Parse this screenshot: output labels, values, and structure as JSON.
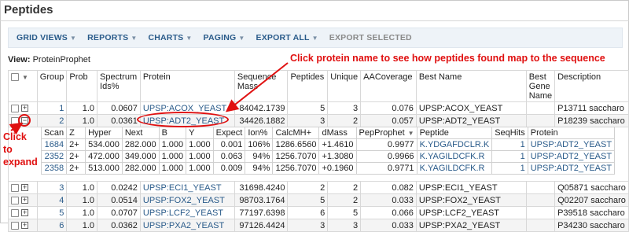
{
  "title": "Peptides",
  "toolbar": {
    "grid_views": "GRID VIEWS",
    "reports": "REPORTS",
    "charts": "CHARTS",
    "paging": "PAGING",
    "export_all": "EXPORT ALL",
    "export_selected": "EXPORT SELECTED"
  },
  "view": {
    "label": "View:",
    "name": "ProteinProphet"
  },
  "columns": [
    "Group",
    "Prob",
    "Spectrum Ids%",
    "Protein",
    "Sequence Mass",
    "Peptides",
    "Unique",
    "AACoverage",
    "Best Name",
    "Best Gene Name",
    "Description"
  ],
  "rows": [
    {
      "group": "1",
      "prob": "1.0",
      "spec": "0.0607",
      "protein": "UPSP:ACOX_YEAST",
      "mass": "84042.1739",
      "peptides": "5",
      "unique": "3",
      "aacov": "0.076",
      "best_name": "UPSP:ACOX_YEAST",
      "desc": "P13711 saccharo"
    },
    {
      "group": "2",
      "prob": "1.0",
      "spec": "0.0361",
      "protein": "UPSP:ADT2_YEAST",
      "mass": "34426.1882",
      "peptides": "3",
      "unique": "2",
      "aacov": "0.057",
      "best_name": "UPSP:ADT2_YEAST",
      "desc": "P18239 saccharo"
    },
    {
      "group": "3",
      "prob": "1.0",
      "spec": "0.0242",
      "protein": "UPSP:ECI1_YEAST",
      "mass": "31698.4240",
      "peptides": "2",
      "unique": "2",
      "aacov": "0.082",
      "best_name": "UPSP:ECI1_YEAST",
      "desc": "Q05871 saccharo"
    },
    {
      "group": "4",
      "prob": "1.0",
      "spec": "0.0514",
      "protein": "UPSP:FOX2_YEAST",
      "mass": "98703.1764",
      "peptides": "5",
      "unique": "2",
      "aacov": "0.033",
      "best_name": "UPSP:FOX2_YEAST",
      "desc": "Q02207 saccharo"
    },
    {
      "group": "5",
      "prob": "1.0",
      "spec": "0.0707",
      "protein": "UPSP:LCF2_YEAST",
      "mass": "77197.6398",
      "peptides": "6",
      "unique": "5",
      "aacov": "0.066",
      "best_name": "UPSP:LCF2_YEAST",
      "desc": "P39518 saccharo"
    },
    {
      "group": "6",
      "prob": "1.0",
      "spec": "0.0362",
      "protein": "UPSP:PXA2_YEAST",
      "mass": "97126.4424",
      "peptides": "3",
      "unique": "3",
      "aacov": "0.033",
      "best_name": "UPSP:PXA2_YEAST",
      "desc": "P34230 saccharo"
    }
  ],
  "sub_columns": [
    "Scan",
    "Z",
    "Hyper",
    "Next",
    "B",
    "Y",
    "Expect",
    "Ion%",
    "CalcMH+",
    "dMass",
    "PepProphet",
    "Peptide",
    "SeqHits",
    "Protein"
  ],
  "sub_rows": [
    {
      "scan": "1684",
      "z": "2+",
      "hyper": "534.000",
      "next": "282.000",
      "b": "1.000",
      "y": "1.000",
      "expect": "0.001",
      "ion": "106%",
      "calc": "1286.6560",
      "dmass": "+1.4610",
      "pep": "0.9977",
      "peptide": "K.YDGAFDCLR.K",
      "seqhits": "1",
      "protein": "UPSP:ADT2_YEAST"
    },
    {
      "scan": "2352",
      "z": "2+",
      "hyper": "472.000",
      "next": "349.000",
      "b": "1.000",
      "y": "1.000",
      "expect": "0.063",
      "ion": "94%",
      "calc": "1256.7070",
      "dmass": "+1.3080",
      "pep": "0.9966",
      "peptide": "K.YAGILDCFK.R",
      "seqhits": "1",
      "protein": "UPSP:ADT2_YEAST"
    },
    {
      "scan": "2358",
      "z": "2+",
      "hyper": "513.000",
      "next": "282.000",
      "b": "1.000",
      "y": "1.000",
      "expect": "0.009",
      "ion": "94%",
      "calc": "1256.7070",
      "dmass": "+0.1960",
      "pep": "0.9771",
      "peptide": "K.YAGILDCFK.R",
      "seqhits": "1",
      "protein": "UPSP:ADT2_YEAST"
    }
  ],
  "annotations": {
    "top": "Click protein name to see how peptides found map to the sequence",
    "left_1": "Click",
    "left_2": "to",
    "left_3": "expand"
  },
  "colors": {
    "link": "#2a5b8a",
    "annotation": "#e01010",
    "toolbar_bg": "#eef3f8"
  }
}
